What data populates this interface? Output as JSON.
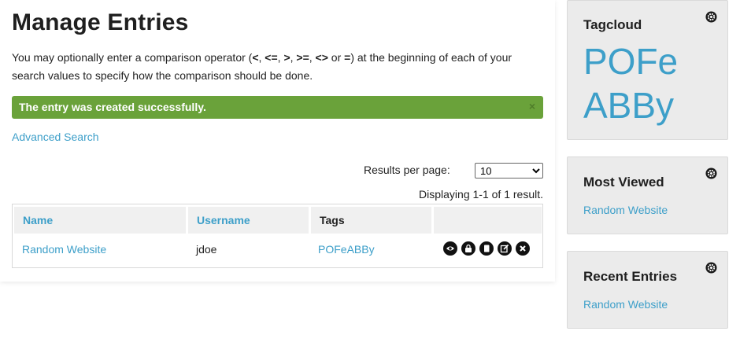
{
  "page": {
    "title": "Manage Entries",
    "intro": "You may optionally enter a comparison operator (<, <=, >, >=, <> or =) at the beginning of each of your search values to specify how the comparison should be done.",
    "intro_parts": [
      "You may optionally enter a comparison operator (",
      "<",
      ", ",
      "<=",
      ", ",
      ">",
      ", ",
      ">=",
      ", ",
      "<>",
      " or ",
      "=",
      ") at the beginning of each of your search values to specify how the comparison should be done."
    ],
    "alert": {
      "text": "The entry was created successfully.",
      "close": "×",
      "color": "#6aa23a"
    },
    "advanced_search": "Advanced Search",
    "results_per_page": {
      "label": "Results per page:",
      "selected": "10"
    },
    "summary": "Displaying 1-1 of 1 result.",
    "table": {
      "headers": [
        "Name",
        "Username",
        "Tags"
      ],
      "rows": [
        {
          "name": "Random Website",
          "username": "jdoe",
          "tags": "POFeABBy"
        }
      ],
      "action_icons": [
        "open-url-icon",
        "password-icon",
        "copy-icon",
        "edit-icon",
        "delete-icon"
      ]
    }
  },
  "sidebar": {
    "tagcloud": {
      "title": "Tagcloud",
      "tags": [
        "POFe",
        "ABBy"
      ]
    },
    "most_viewed": {
      "title": "Most Viewed",
      "items": [
        "Random Website"
      ]
    },
    "recent_entries": {
      "title": "Recent Entries",
      "items": [
        "Random Website"
      ]
    }
  },
  "colors": {
    "link": "#3d9fc9",
    "success": "#6aa23a",
    "panel": "#ebebeb"
  }
}
